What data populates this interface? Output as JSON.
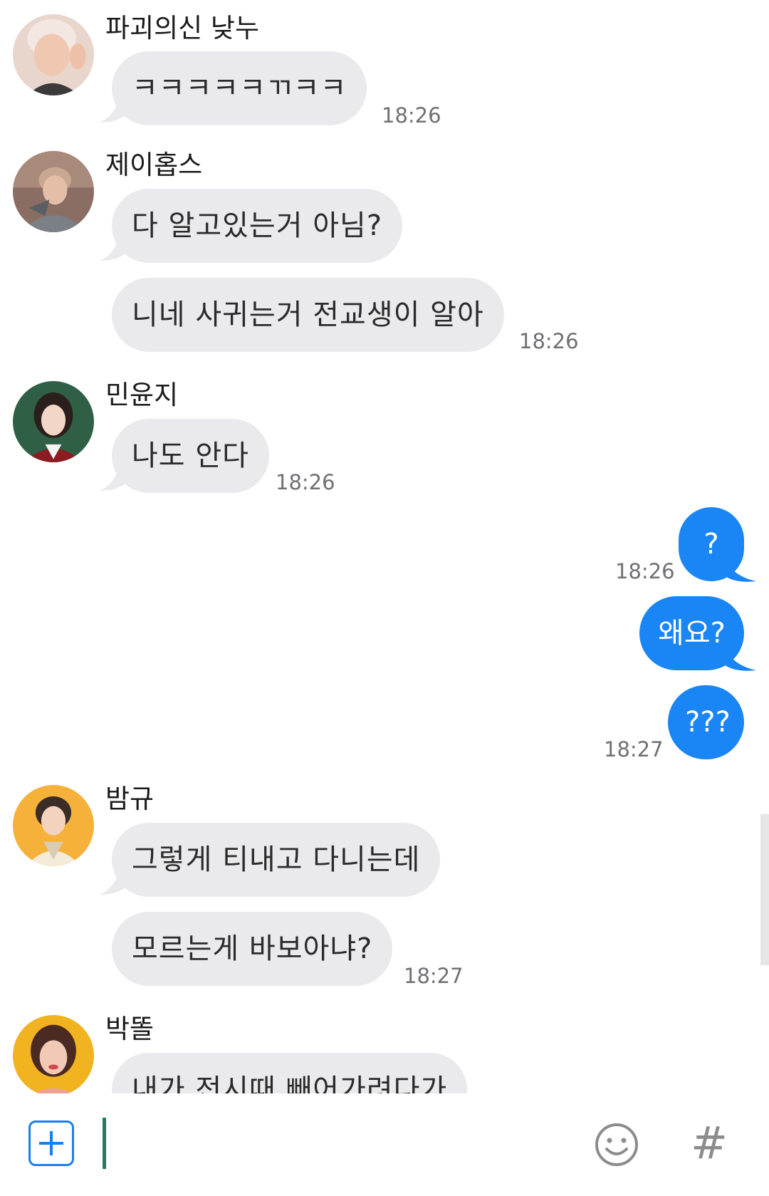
{
  "messages": [
    {
      "sender": "파괴의신 낮누",
      "lines": [
        "ㅋㅋㅋㅋㅋㄲㅋㅋ"
      ],
      "time": "18:26"
    },
    {
      "sender": "제이홉스",
      "lines": [
        "다 알고있는거 아님?",
        "니네 사귀는거 전교생이 알아"
      ],
      "time": "18:26"
    },
    {
      "sender": "민윤지",
      "lines": [
        "나도 안다"
      ],
      "time": "18:26"
    },
    {
      "sender": "밤규",
      "lines": [
        "그렇게 티내고 다니는데",
        "모르는게 바보아냐?"
      ],
      "time": "18:27"
    },
    {
      "sender": "박똘",
      "lines": [
        "내가 전시때 빼어가려다가"
      ],
      "time": ""
    }
  ],
  "my_messages": [
    {
      "text": "?",
      "time": "18:26"
    },
    {
      "text": "왜요?",
      "time": ""
    },
    {
      "text": "???",
      "time": "18:27"
    }
  ],
  "composer": {
    "input_value": "",
    "emoji_icon": "smiley-icon",
    "hash_label": "#",
    "attach_icon": "plus-icon"
  },
  "colors": {
    "my_bubble": "#1a85f5",
    "their_bubble": "#eaeaec",
    "accent": "#1a7ff0"
  }
}
